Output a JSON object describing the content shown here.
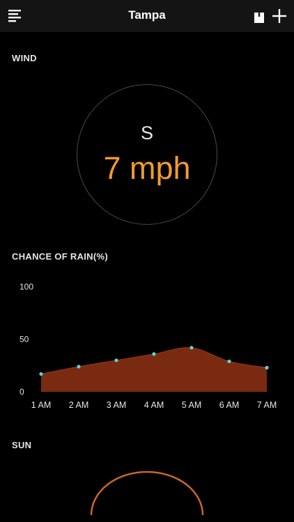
{
  "header": {
    "title": "Tampa",
    "menu_icon": "menu-lines-icon",
    "share_icon": "share-icon",
    "add_icon": "plus-icon"
  },
  "wind": {
    "label": "WIND",
    "direction": "S",
    "speed": "7 mph",
    "speed_color": "#f29a2e"
  },
  "rain": {
    "label": "CHANCE OF RAIN(%)"
  },
  "sun": {
    "label": "SUN",
    "arc_color": "#c9662a"
  },
  "chart_data": {
    "type": "area",
    "title": "CHANCE OF RAIN(%)",
    "categories": [
      "1 AM",
      "2 AM",
      "3 AM",
      "4 AM",
      "5 AM",
      "6 AM",
      "7 AM"
    ],
    "values": [
      17,
      24,
      30,
      36,
      42,
      29,
      23
    ],
    "ylim": [
      0,
      100
    ],
    "yticks": [
      "100",
      "50",
      "0"
    ],
    "fill_color": "#7a2a10",
    "point_color": "#5ad3d8",
    "grid": false,
    "legend": "none"
  }
}
